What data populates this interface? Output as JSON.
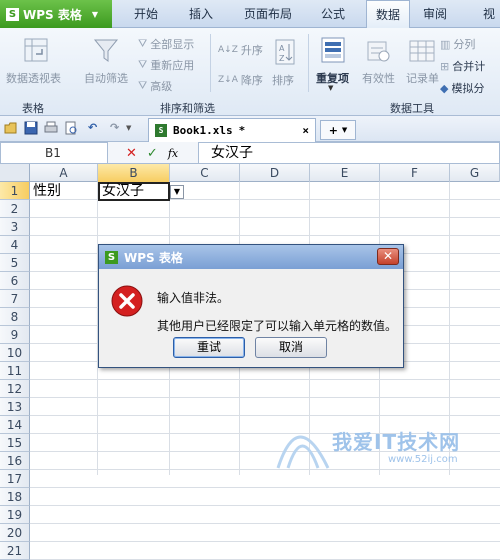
{
  "app": {
    "button_label": "WPS 表格",
    "logo_char": "S"
  },
  "menu": {
    "tabs": [
      "开始",
      "插入",
      "页面布局",
      "公式",
      "数据",
      "审阅",
      "视"
    ],
    "active": "数据"
  },
  "ribbon": {
    "pivot_label": "数据透视表",
    "autofilter_label": "自动筛选",
    "show_all": "全部显示",
    "reapply": "重新应用",
    "advanced": "高级",
    "sort_asc": "升序",
    "sort_desc": "降序",
    "sort": "排序",
    "duplicates": "重复项",
    "validity": "有效性",
    "record": "记录单",
    "split": "分列",
    "merge_calc": "合并计",
    "simulate": "模拟分",
    "group_table": "表格",
    "group_sort_filter": "排序和筛选",
    "group_data_tools": "数据工具",
    "sort_a_z": "A↓Z",
    "sort_z_a": "Z↓A"
  },
  "document_tab": {
    "filename": "Book1.xls",
    "modified_mark": "*",
    "close": "×",
    "new_tab": "+"
  },
  "formula_bar": {
    "cell_ref": "B1",
    "cancel": "✕",
    "confirm": "✓",
    "fx": "fx",
    "content": "女汉子"
  },
  "grid": {
    "columns": [
      "A",
      "B",
      "C",
      "D",
      "E",
      "F",
      "G"
    ],
    "rows": [
      "1",
      "2",
      "3",
      "4",
      "5",
      "6",
      "7",
      "8",
      "9",
      "10",
      "11",
      "12",
      "13",
      "14",
      "15",
      "16",
      "17",
      "18",
      "19",
      "20",
      "21"
    ],
    "selected_column": "B",
    "selected_row": "1",
    "cells": {
      "A1": "性别",
      "B1": "女汉子"
    }
  },
  "dialog": {
    "title": "WPS 表格",
    "message_line1": "输入值非法。",
    "message_line2": "其他用户已经限定了可以输入单元格的数值。",
    "retry_button": "重试",
    "cancel_button": "取消",
    "close": "✕"
  },
  "watermark": {
    "text": "我爱IT技术网",
    "url": "www.52ij.com"
  },
  "colors": {
    "accent_green": "#3c9a1f",
    "error_red": "#d42020",
    "selection": "#f7cd61"
  }
}
